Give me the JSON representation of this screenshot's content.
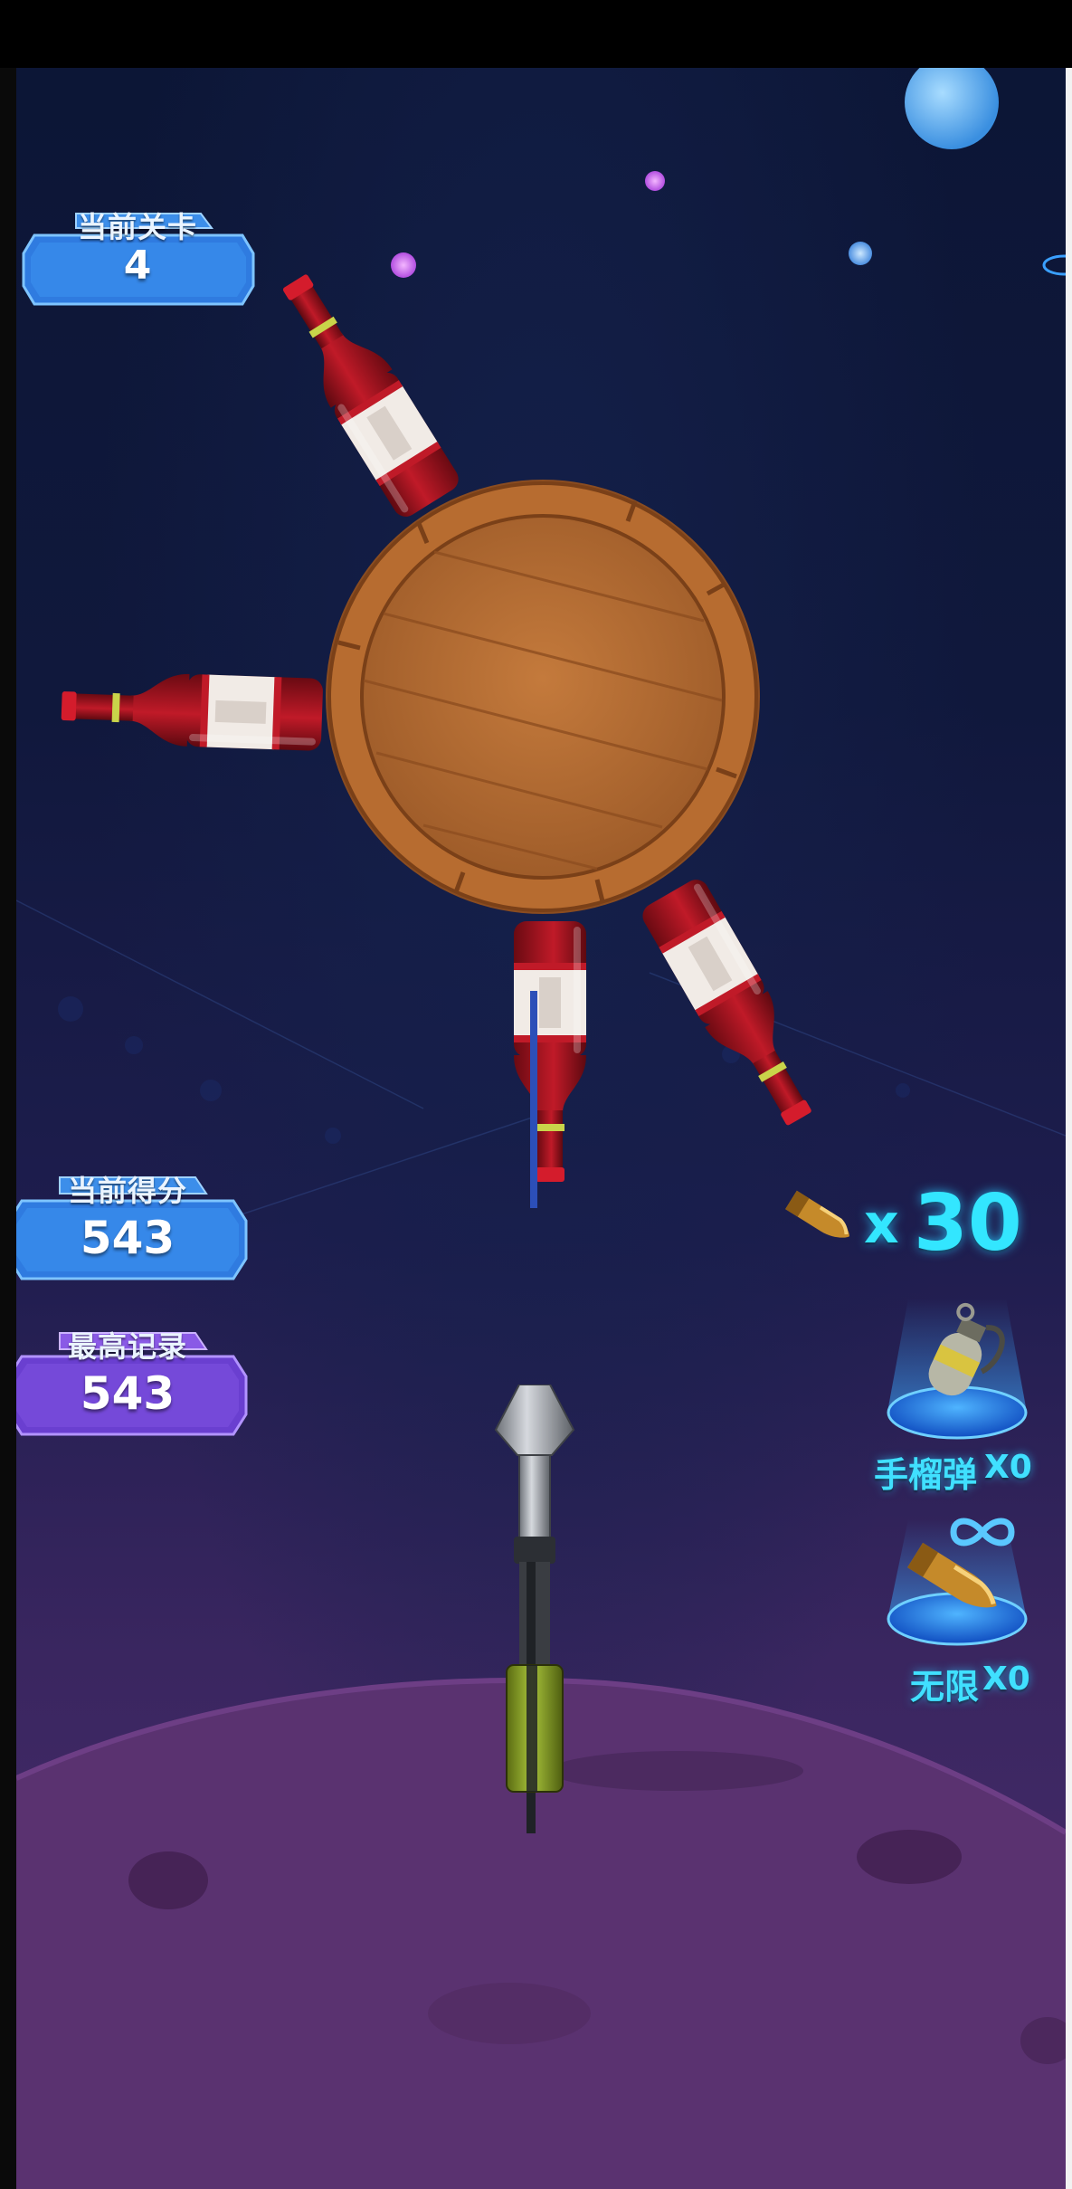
{
  "hud": {
    "level": {
      "label": "当前关卡",
      "value": "4"
    },
    "score": {
      "label": "当前得分",
      "value": "543"
    },
    "best": {
      "label": "最高记录",
      "value": "543"
    }
  },
  "ammo": {
    "prefix": "x",
    "count": "30"
  },
  "powerups": {
    "grenade": {
      "label": "手榴弹",
      "count": "X0"
    },
    "infinite": {
      "label": "无限",
      "count": "X0"
    }
  },
  "colors": {
    "hud_blue": "#2f82e6",
    "hud_purple": "#6a3fd0",
    "ammo_cyan": "#33e6ff",
    "barrel_wood": "#b56a32",
    "wine_red": "#9b111e",
    "planet_purple": "#5a3270"
  }
}
